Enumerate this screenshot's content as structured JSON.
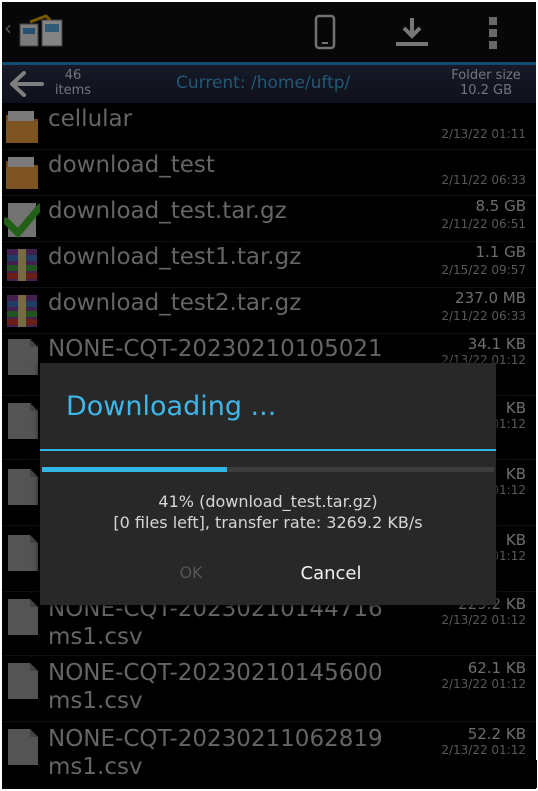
{
  "header": {
    "icons": [
      "back-chevron-icon",
      "app-logo-icon",
      "phone-icon",
      "download-icon",
      "overflow-menu-icon"
    ]
  },
  "infobar": {
    "item_count": "46",
    "items_label": "items",
    "current_path": "Current: /home/uftp/",
    "folder_size_label": "Folder size",
    "folder_size_value": "10.2 GB"
  },
  "files": [
    {
      "name": "cellular",
      "size": "",
      "date": "2/13/22 01:11",
      "icon": "folder-icon"
    },
    {
      "name": "download_test",
      "size": "",
      "date": "2/11/22 06:33",
      "icon": "folder-icon"
    },
    {
      "name": "download_test.tar.gz",
      "size": "8.5 GB",
      "date": "2/11/22 06:51",
      "icon": "checkmark-icon"
    },
    {
      "name": "download_test1.tar.gz",
      "size": "1.1 GB",
      "date": "2/15/22 09:57",
      "icon": "archive-icon"
    },
    {
      "name": "download_test2.tar.gz",
      "size": "237.0 MB",
      "date": "2/11/22 06:33",
      "icon": "archive-icon"
    },
    {
      "name": "NONE-CQT-20230210105021",
      "size": "34.1 KB",
      "date": "2/13/22 01:12",
      "icon": "file-icon"
    },
    {
      "name": "",
      "size": "KB",
      "date": "01:12",
      "icon": "file-icon"
    },
    {
      "name": "",
      "size": "KB",
      "date": "01:12",
      "icon": "file-icon"
    },
    {
      "name": "",
      "size": "KB",
      "date": "01:12",
      "icon": "file-icon"
    },
    {
      "name": "NONE-CQT-20230210144716 ms1.csv",
      "size": "229.2 KB",
      "date": "2/13/22 01:12",
      "icon": "file-icon"
    },
    {
      "name": "NONE-CQT-20230210145600 ms1.csv",
      "size": "62.1 KB",
      "date": "2/13/22 01:12",
      "icon": "file-icon"
    },
    {
      "name": "NONE-CQT-20230211062819 ms1.csv",
      "size": "52.2 KB",
      "date": "2/13/22 01:12",
      "icon": "file-icon"
    }
  ],
  "dialog": {
    "title": "Downloading ...",
    "progress_line1": "41% (download_test.tar.gz)",
    "progress_line2": "[0 files left], transfer rate: 3269.2 KB/s",
    "progress_fraction": 0.41,
    "ok_label": "OK",
    "cancel_label": "Cancel"
  },
  "colors": {
    "accent": "#33b5e5",
    "background": "#000000",
    "dialog_background": "#282828"
  }
}
